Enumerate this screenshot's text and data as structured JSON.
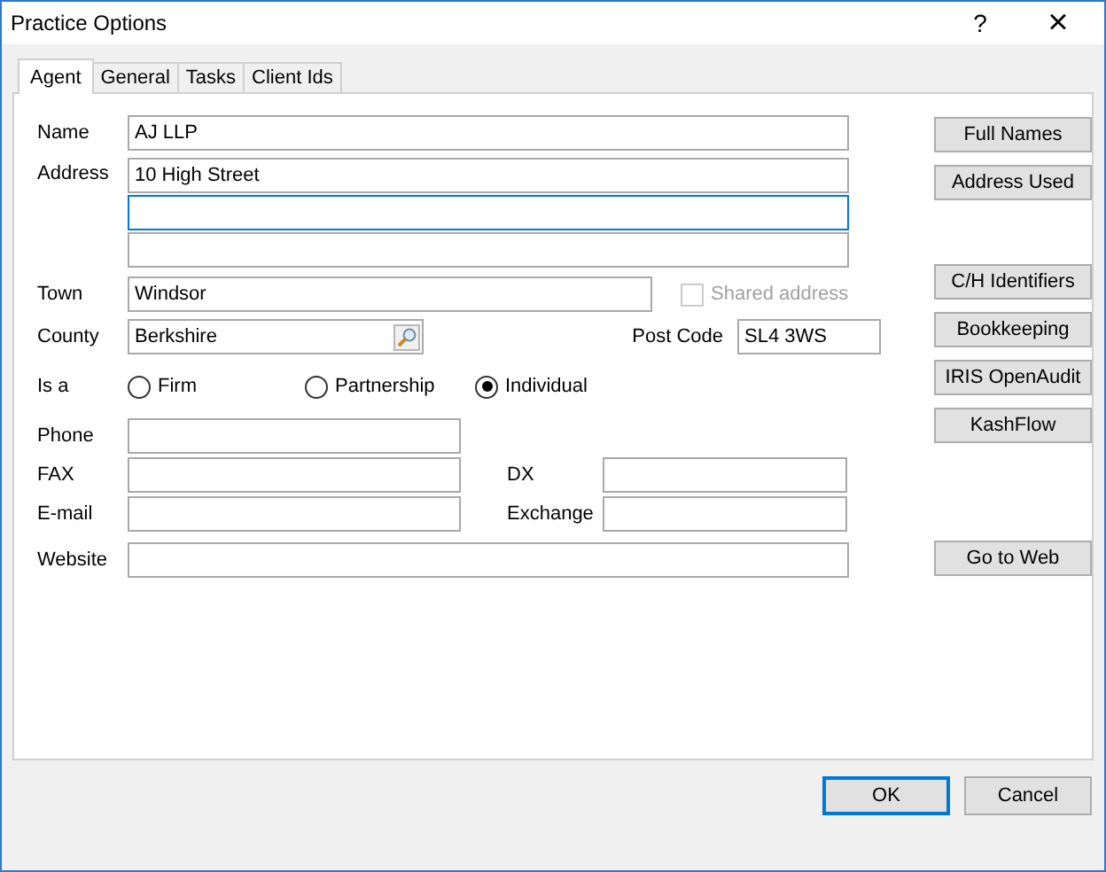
{
  "window": {
    "title": "Practice Options",
    "help": "?",
    "close": "×"
  },
  "tabs": [
    {
      "label": "Agent",
      "selected": true
    },
    {
      "label": "General",
      "selected": false
    },
    {
      "label": "Tasks",
      "selected": false
    },
    {
      "label": "Client Ids",
      "selected": false
    }
  ],
  "name": {
    "label": "Name",
    "value": "AJ LLP"
  },
  "address": {
    "label": "Address",
    "lines": [
      {
        "value": "10 High Street",
        "focused": false
      },
      {
        "focused": true
      },
      {
        "focused": false
      }
    ]
  },
  "town": {
    "label": "Town",
    "value": "Windsor"
  },
  "shared_address": {
    "label": "Shared address",
    "checked": false,
    "disabled": true
  },
  "county": {
    "label": "County",
    "value": "Berkshire"
  },
  "post_code": {
    "label": "Post Code",
    "value": "SL4 3WS"
  },
  "is_a": {
    "label": "Is a",
    "options": [
      {
        "label": "Firm",
        "selected": false
      },
      {
        "label": "Partnership",
        "selected": false
      },
      {
        "label": "Individual",
        "selected": true
      }
    ]
  },
  "phone": {
    "label": "Phone"
  },
  "fax": {
    "label": "FAX"
  },
  "dx": {
    "label": "DX"
  },
  "email": {
    "label": "E-mail"
  },
  "exchange": {
    "label": "Exchange"
  },
  "website": {
    "label": "Website"
  },
  "side_buttons": [
    [
      "Full Names",
      "Address Used"
    ],
    [
      "C/H Identifiers",
      "Bookkeeping",
      "IRIS OpenAudit",
      "KashFlow"
    ],
    [
      "Go to Web"
    ]
  ],
  "footer_buttons": [
    {
      "label": "OK",
      "default": true
    },
    {
      "label": "Cancel",
      "default": false
    }
  ]
}
